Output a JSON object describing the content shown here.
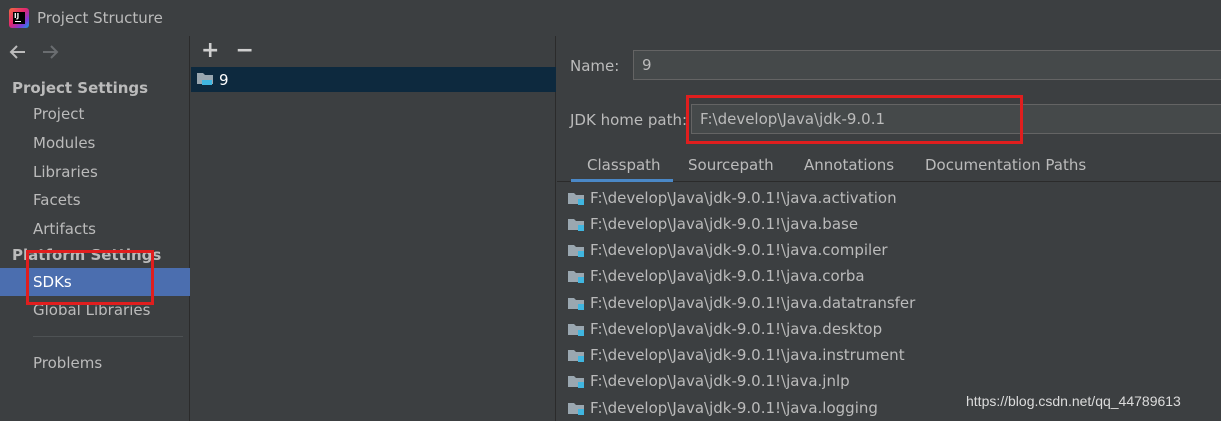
{
  "window": {
    "title": "Project Structure"
  },
  "nav": {
    "project_settings_title": "Project Settings",
    "project_settings": [
      "Project",
      "Modules",
      "Libraries",
      "Facets",
      "Artifacts"
    ],
    "platform_settings_title": "Platform Settings",
    "platform_settings": [
      "SDKs",
      "Global Libraries"
    ],
    "problems": "Problems",
    "selected": "SDKs"
  },
  "sdk_list": {
    "add": "+",
    "remove": "−",
    "items": [
      "9"
    ]
  },
  "details": {
    "name_label": "Name:",
    "name_value": "9",
    "jdk_home_label": "JDK home path:",
    "jdk_home_value": "F:\\develop\\Java\\jdk-9.0.1",
    "tabs": [
      "Classpath",
      "Sourcepath",
      "Annotations",
      "Documentation Paths"
    ],
    "active_tab": "Classpath",
    "classpath": [
      "F:\\develop\\Java\\jdk-9.0.1!\\java.activation",
      "F:\\develop\\Java\\jdk-9.0.1!\\java.base",
      "F:\\develop\\Java\\jdk-9.0.1!\\java.compiler",
      "F:\\develop\\Java\\jdk-9.0.1!\\java.corba",
      "F:\\develop\\Java\\jdk-9.0.1!\\java.datatransfer",
      "F:\\develop\\Java\\jdk-9.0.1!\\java.desktop",
      "F:\\develop\\Java\\jdk-9.0.1!\\java.instrument",
      "F:\\develop\\Java\\jdk-9.0.1!\\java.jnlp",
      "F:\\develop\\Java\\jdk-9.0.1!\\java.logging"
    ]
  },
  "watermark": "https://blog.csdn.net/qq_44789613",
  "colors": {
    "background": "#3c3f41",
    "selection": "#4b6eaf",
    "list_selection": "#0d293e",
    "highlight_box": "#e01e1e",
    "tab_underline": "#4a88c7"
  }
}
